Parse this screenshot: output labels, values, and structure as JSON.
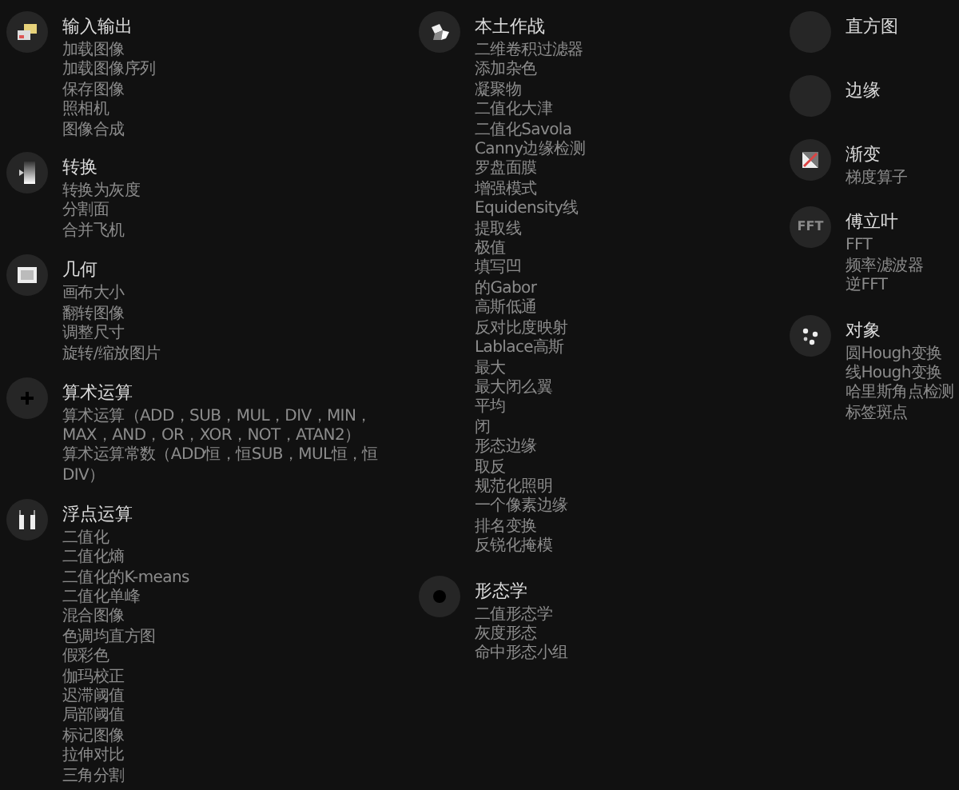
{
  "columns": [
    {
      "sections": [
        {
          "kind": "io",
          "title": "输入输出",
          "items": [
            "加载图像",
            "加载图像序列",
            "保存图像",
            "照相机",
            "图像合成"
          ]
        },
        {
          "kind": "convert",
          "title": "转换",
          "items": [
            "转换为灰度",
            "分割面",
            "合并飞机"
          ]
        },
        {
          "kind": "geometry",
          "title": "几何",
          "items": [
            "画布大小",
            "翻转图像",
            "调整尺寸",
            "旋转/缩放图片"
          ]
        },
        {
          "kind": "plus",
          "title": "算术运算",
          "items": [
            "算术运算（ADD，SUB，MUL，DIV，MIN，MAX，AND，OR，XOR，NOT，ATAN2）",
            "算术运算常数（ADD恒，恒SUB，MUL恒，恒DIV）"
          ]
        },
        {
          "kind": "float",
          "title": "浮点运算",
          "items": [
            "二值化",
            "二值化熵",
            "二值化的K-means",
            "二值化单峰",
            "混合图像",
            "色调均直方图",
            "假彩色",
            "伽玛校正",
            "迟滞阈值",
            "局部阈值",
            "标记图像",
            "拉伸对比",
            "三角分割"
          ]
        }
      ]
    },
    {
      "sections": [
        {
          "kind": "native",
          "title": "本土作战",
          "items": [
            "二维卷积过滤器",
            "添加杂色",
            "凝聚物",
            "二值化大津",
            "二值化Savola",
            "Canny边缘检测",
            "罗盘面膜",
            "增强模式",
            "Equidensity线",
            "提取线",
            "极值",
            "填写凹",
            "的Gabor",
            "高斯低通",
            "反对比度映射",
            "Lablace高斯",
            "最大",
            "最大闭么翼",
            "平均",
            "闭",
            "形态边缘",
            "取反",
            "规范化照明",
            "一个像素边缘",
            "排名变换",
            "反锐化掩模"
          ]
        },
        {
          "kind": "morph",
          "title": "形态学",
          "items": [
            "二值形态学",
            "灰度形态",
            "命中形态小组"
          ]
        }
      ]
    },
    {
      "sections": [
        {
          "kind": "blank",
          "title": "直方图"
        },
        {
          "kind": "blank",
          "title": "边缘"
        },
        {
          "kind": "gradient",
          "title": "渐变",
          "items": [
            "梯度算子"
          ]
        },
        {
          "kind": "fft",
          "icon_text": "FFT",
          "title": "傅立叶",
          "items": [
            "FFT",
            "频率滤波器",
            "逆FFT"
          ]
        },
        {
          "kind": "objects",
          "title": "对象",
          "items": [
            "圆Hough变换",
            "线Hough变换",
            "哈里斯角点检测",
            "标签斑点"
          ]
        }
      ]
    }
  ]
}
